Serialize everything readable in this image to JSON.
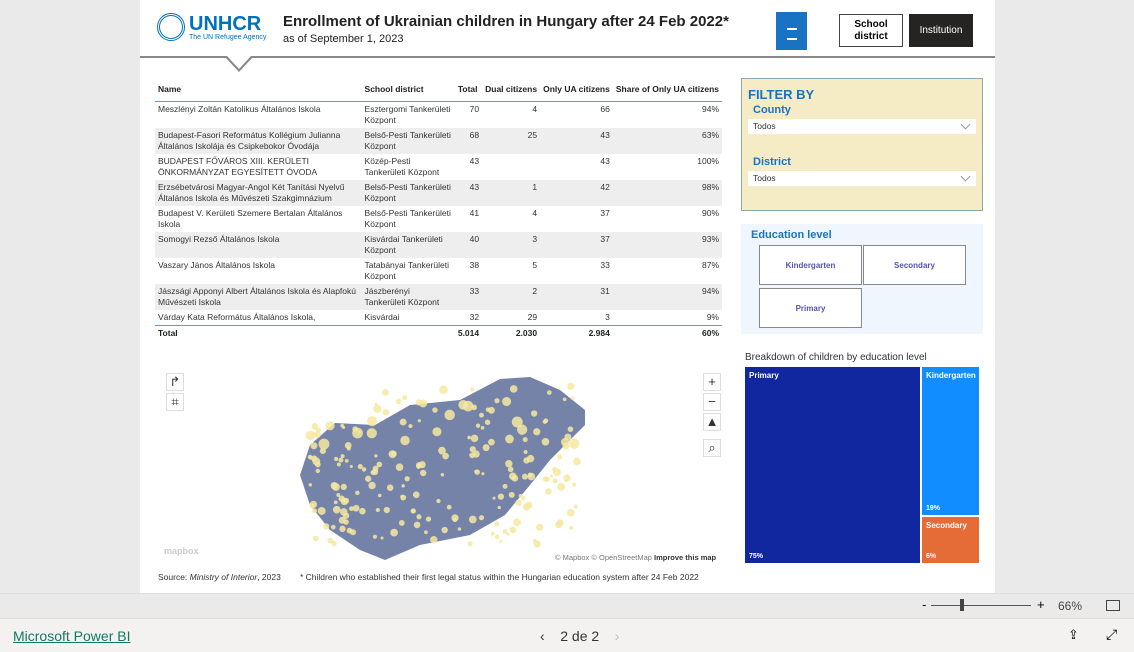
{
  "header": {
    "logo_text": "UNHCR",
    "logo_tagline": "The UN Refugee Agency",
    "title": "Enrollment of Ukrainian children in Hungary after 24 Feb 2022*",
    "subtitle": "as of September 1, 2023",
    "btn_school_district": "School district",
    "btn_institution": "Institution"
  },
  "table": {
    "columns": [
      "Name",
      "School district",
      "Total",
      "Dual citizens",
      "Only UA citizens",
      "Share of Only UA citizens"
    ],
    "rows": [
      [
        "Meszlényi Zoltán Katolikus Általános Iskola",
        "Esztergomi Tankerületi Központ",
        "70",
        "4",
        "66",
        "94%"
      ],
      [
        "Budapest-Fasori Református Kollégium Julianna Általános Iskolája és Csipkebokor Óvodája",
        "Belső-Pesti Tankerületi Központ",
        "68",
        "25",
        "43",
        "63%"
      ],
      [
        "BUDAPEST FŐVÁROS XIII. KERÜLETI ÖNKORMÁNYZAT EGYESÍTETT ÓVODA",
        "Közép-Pesti Tankerületi Központ",
        "43",
        "",
        "43",
        "100%"
      ],
      [
        "Erzsébetvárosi Magyar-Angol Két Tanítási Nyelvű Általános Iskola és Művészeti Szakgimnázium",
        "Belső-Pesti Tankerületi Központ",
        "43",
        "1",
        "42",
        "98%"
      ],
      [
        "Budapest V. Kerületi Szemere Bertalan Általános Iskola",
        "Belső-Pesti Tankerületi Központ",
        "41",
        "4",
        "37",
        "90%"
      ],
      [
        "Somogyi Rezső Általános Iskola",
        "Kisvárdai Tankerületi Központ",
        "40",
        "3",
        "37",
        "93%"
      ],
      [
        "Vaszary János Általános Iskola",
        "Tatabányai Tankerületi Központ",
        "38",
        "5",
        "33",
        "87%"
      ],
      [
        "Jászsági Apponyi Albert Általános Iskola és Alapfokú Művészeti Iskola",
        "Jászberényi Tankerületi Központ",
        "33",
        "2",
        "31",
        "94%"
      ],
      [
        "Várday Kata Református Általános Iskola,",
        "Kisvárdai",
        "32",
        "29",
        "3",
        "9%"
      ]
    ],
    "total": [
      "Total",
      "",
      "5.014",
      "2.030",
      "2.984",
      "60%"
    ]
  },
  "filter": {
    "heading": "FILTER BY",
    "county_label": "County",
    "county_value": "Todos",
    "district_label": "District",
    "district_value": "Todos"
  },
  "education": {
    "label": "Education level",
    "options": [
      "Kindergarten",
      "Secondary",
      "Primary"
    ]
  },
  "treemap": {
    "title": "Breakdown of children by education level",
    "items": [
      {
        "label": "Primary",
        "share": "75%",
        "value": 75,
        "color": "#1127a0"
      },
      {
        "label": "Kindergarten",
        "share": "19%",
        "value": 19,
        "color": "#118dff"
      },
      {
        "label": "Secondary",
        "share": "6%",
        "value": 6,
        "color": "#e66c37"
      }
    ]
  },
  "map": {
    "attribution": "© Mapbox © OpenStreetMap",
    "improve": "Improve this map",
    "mapbox_logo": "mapbox",
    "zoom_in": "+",
    "zoom_out": "−",
    "land_color": "#7683a8",
    "dot_color": "#f6e8a0"
  },
  "source": {
    "prefix": "Source: ",
    "name": "Ministry of Interior",
    "suffix": ", 2023"
  },
  "note": "* Children who established their first legal status within the Hungarian education system after 24 Feb 2022",
  "zoom": {
    "minus": "-",
    "plus": "+",
    "level": "66%"
  },
  "footer": {
    "brand": "Microsoft Power BI",
    "page": "2 de 2"
  }
}
